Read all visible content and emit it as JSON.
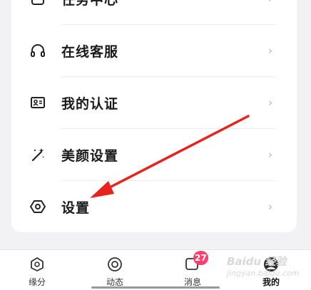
{
  "menu": {
    "items": [
      {
        "label": "任务中心",
        "icon": "task-icon"
      },
      {
        "label": "在线客服",
        "icon": "headphones-icon"
      },
      {
        "label": "我的认证",
        "icon": "id-card-icon"
      },
      {
        "label": "美颜设置",
        "icon": "magic-wand-icon"
      },
      {
        "label": "设置",
        "icon": "hexagon-settings-icon"
      }
    ],
    "chevron": "›"
  },
  "tabbar": {
    "tabs": [
      {
        "label": "缘分",
        "icon": "fate-icon"
      },
      {
        "label": "动态",
        "icon": "moments-icon"
      },
      {
        "label": "消息",
        "icon": "message-icon",
        "badge": "27"
      },
      {
        "label": "我的",
        "icon": "avatar",
        "active": true
      }
    ]
  },
  "watermark": {
    "text": "Baidu 经验",
    "subtext": "jingyan.baidu.com"
  },
  "colors": {
    "arrow": "#e8231f",
    "badge": "#ff3d6e"
  }
}
